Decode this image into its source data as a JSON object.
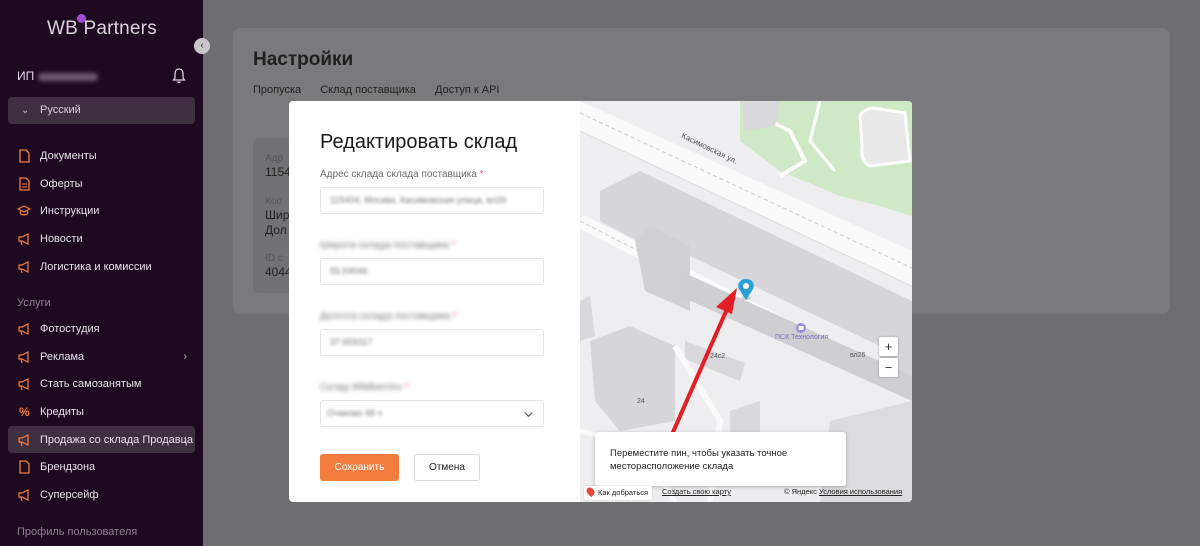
{
  "sidebar": {
    "logo": "WB Partners",
    "user_prefix": "ИП",
    "language": "Русский",
    "items": [
      {
        "label": "Документы",
        "icon": "document-icon"
      },
      {
        "label": "Оферты",
        "icon": "offer-icon"
      },
      {
        "label": "Инструкции",
        "icon": "graduation-cap-icon"
      },
      {
        "label": "Новости",
        "icon": "megaphone-icon"
      },
      {
        "label": "Логистика и комиссии",
        "icon": "megaphone-icon"
      }
    ],
    "services_title": "Услуги",
    "services": [
      {
        "label": "Фотостудия",
        "icon": "megaphone-icon"
      },
      {
        "label": "Реклама",
        "icon": "megaphone-icon"
      },
      {
        "label": "Стать самозанятым",
        "icon": "megaphone-icon"
      },
      {
        "label": "Кредиты",
        "icon": "percent-icon"
      },
      {
        "label": "Продажа со склада Продавца",
        "icon": "megaphone-icon"
      },
      {
        "label": "Брендзона",
        "icon": "document-icon"
      },
      {
        "label": "Суперсейф",
        "icon": "megaphone-icon"
      }
    ],
    "profile_title": "Профиль пользователя"
  },
  "page": {
    "title": "Настройки",
    "tabs": [
      "Пропуска",
      "Склад поставщика",
      "Доступ к API"
    ],
    "fragments": [
      "Адр",
      "1154",
      "Коо",
      "Шир",
      "Дол",
      "ID с",
      "4044"
    ]
  },
  "modal": {
    "title": "Редактировать склад",
    "address_label": "Адрес склада склада поставщика",
    "address_value": "115404, Москва, Касимовская улица, вл26",
    "latitude_label": "Широта склада поставщика",
    "latitude_value": "55.59046",
    "longitude_label": "Долгота склада поставщика",
    "longitude_value": "37.659317",
    "warehouse_label": "Склад Wildberries",
    "warehouse_value": "Очаково 48 ч",
    "required_mark": "*",
    "save_label": "Сохранить",
    "cancel_label": "Отмена"
  },
  "map": {
    "street": "Касимовская ул.",
    "poi": "ПСК Технология",
    "building_1": "вл26",
    "building_2": "24с2",
    "building_3": "24",
    "zoom_in": "+",
    "zoom_out": "−",
    "hint": "Переместите пин, чтобы указать точное месторасположение склада",
    "route_link": "Как добраться",
    "create_map": "Создать свою карту",
    "copyright": "© Яндекс",
    "terms": "Условия использования",
    "pin_color": "#2a9fd8",
    "arrow_color": "#e31e24"
  },
  "colors": {
    "sidebar_bg": "#1d0a20",
    "accent": "#f27d3f",
    "required": "#e8477a"
  }
}
